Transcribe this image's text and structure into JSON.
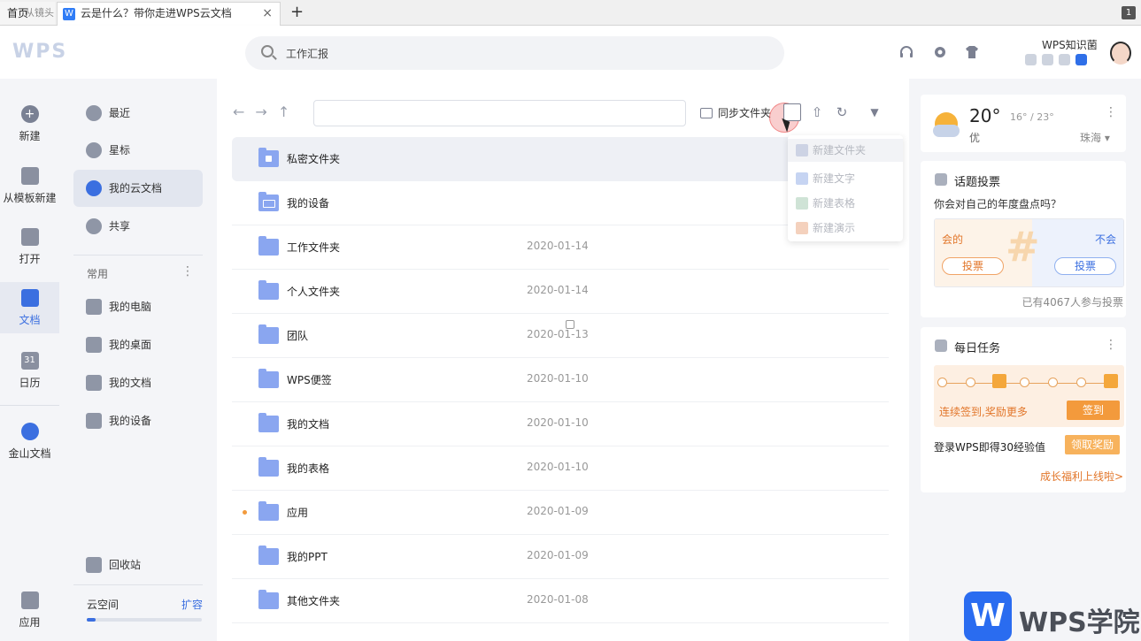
{
  "tabbar": {
    "home_label": "首页",
    "home_ghost": "从镜头",
    "doc_title": "云是什么？带你走进WPS云文档",
    "doc_icon": "W",
    "close": "×",
    "add": "+",
    "count": "1"
  },
  "header": {
    "logo": "WPS",
    "search_value": "工作汇报",
    "username": "WPS知识菌"
  },
  "rail": {
    "new": "新建",
    "template": "从模板新建",
    "open": "打开",
    "docs": "文档",
    "calendar": "日历",
    "calendar_icon": "31",
    "kingsoft": "金山文档",
    "apps": "应用"
  },
  "nav": {
    "recent": "最近",
    "star": "星标",
    "mycloud": "我的云文档",
    "share": "共享",
    "common": "常用",
    "common_menu": "⋮",
    "my_pc": "我的电脑",
    "my_desktop": "我的桌面",
    "my_docs": "我的文档",
    "my_devices": "我的设备",
    "trash": "回收站",
    "space_label": "云空间",
    "space_expand": "扩容",
    "space_used_fraction": 0.08
  },
  "toolbar": {
    "back": "←",
    "forward": "→",
    "up": "↑",
    "sync_label": "同步文件夹",
    "upload": "⇧",
    "refresh": "↻",
    "filter": "▼"
  },
  "files": [
    {
      "name": "私密文件夹",
      "date": "",
      "kind": "lock",
      "dot": false
    },
    {
      "name": "我的设备",
      "date": "",
      "kind": "dev",
      "dot": false
    },
    {
      "name": "工作文件夹",
      "date": "2020-01-14",
      "kind": "folder",
      "dot": false
    },
    {
      "name": "个人文件夹",
      "date": "2020-01-14",
      "kind": "folder",
      "dot": false
    },
    {
      "name": "团队",
      "date": "2020-01-13",
      "kind": "folder",
      "dot": false
    },
    {
      "name": "WPS便签",
      "date": "2020-01-10",
      "kind": "folder",
      "dot": false
    },
    {
      "name": "我的文档",
      "date": "2020-01-10",
      "kind": "folder",
      "dot": false
    },
    {
      "name": "我的表格",
      "date": "2020-01-10",
      "kind": "folder",
      "dot": false
    },
    {
      "name": "应用",
      "date": "2020-01-09",
      "kind": "folder",
      "dot": true
    },
    {
      "name": "我的PPT",
      "date": "2020-01-09",
      "kind": "folder",
      "dot": false
    },
    {
      "name": "其他文件夹",
      "date": "2020-01-08",
      "kind": "folder",
      "dot": false
    }
  ],
  "dropdown": {
    "new_folder": "新建文件夹",
    "new_text": "新建文字",
    "new_sheet": "新建表格",
    "new_slides": "新建演示"
  },
  "weather": {
    "temp": "20°",
    "range": "16° / 23°",
    "quality": "优",
    "city": "珠海 ▾",
    "menu": "⋮"
  },
  "vote": {
    "title": "话题投票",
    "question": "你会对自己的年度盘点吗？",
    "yes": "会的",
    "no": "不会",
    "vote_btn": "投票",
    "count": "已有4067人参与投票"
  },
  "task": {
    "title": "每日任务",
    "menu": "⋮",
    "streak": "连续签到,奖励更多",
    "sign_btn": "签到",
    "login_text": "登录WPS即得30经验值",
    "reward_btn": "领取奖励",
    "link": "成长福利上线啦>"
  },
  "watermark": {
    "icon": "W",
    "text": "WPS学院"
  },
  "colors": {
    "accent": "#3b6fe0",
    "orange": "#f39a3c",
    "folder": "#8aa6f0"
  }
}
